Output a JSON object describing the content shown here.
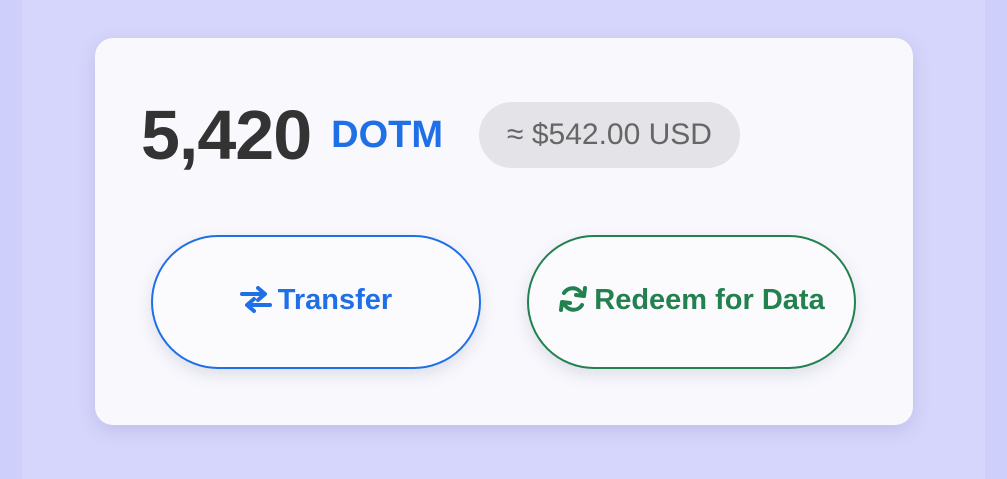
{
  "balance": {
    "amount": "5,420",
    "unit": "DOTM",
    "usd_equivalent": "≈ $542.00 USD"
  },
  "actions": {
    "transfer": {
      "label": "Transfer",
      "icon": "transfer-arrows-icon",
      "color": "#1f6fe6"
    },
    "redeem": {
      "label": "Redeem for Data",
      "icon": "refresh-icon",
      "color": "#23804f"
    }
  },
  "colors": {
    "page_background": "#cfcffb",
    "card_background": "#f8f8fd",
    "amount_text": "#333333",
    "pill_background": "#e3e3e8",
    "pill_text": "#666666"
  }
}
